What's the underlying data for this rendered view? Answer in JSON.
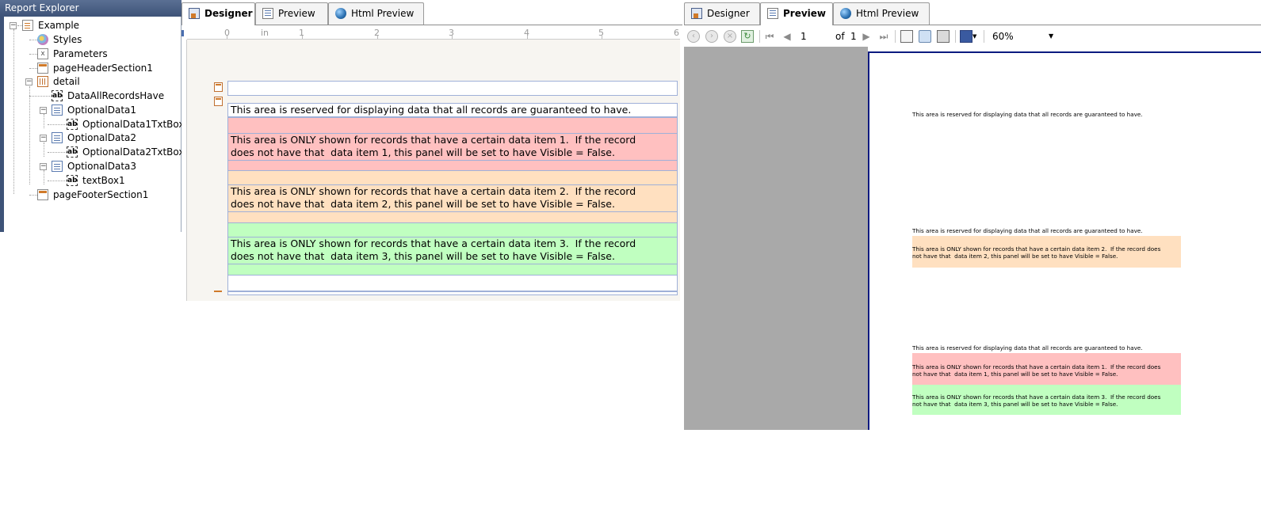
{
  "explorer": {
    "title": "Report Explorer",
    "items": [
      {
        "label": "Example"
      },
      {
        "label": "Styles"
      },
      {
        "label": "Parameters"
      },
      {
        "label": "pageHeaderSection1"
      },
      {
        "label": "detail"
      },
      {
        "label": "DataAllRecordsHave"
      },
      {
        "label": "OptionalData1"
      },
      {
        "label": "OptionalData1TxtBox"
      },
      {
        "label": "OptionalData2"
      },
      {
        "label": "OptionalData2TxtBox"
      },
      {
        "label": "OptionalData3"
      },
      {
        "label": "textBox1"
      },
      {
        "label": "pageFooterSection1"
      }
    ],
    "textbox_glyph": "ab",
    "params_glyph": "x",
    "expander_minus": "−"
  },
  "left_tabs": {
    "designer": "Designer",
    "preview": "Preview",
    "html_preview": "Html Preview",
    "active": "Designer"
  },
  "right_tabs": {
    "designer": "Designer",
    "preview": "Preview",
    "html_preview": "Html Preview",
    "active": "Preview"
  },
  "ruler": {
    "unit": "in",
    "numbers": [
      "0",
      "1",
      "2",
      "3",
      "4",
      "5",
      "6"
    ]
  },
  "designer": {
    "all_records_text": "This area is reserved for displaying data that all records are guaranteed to have.",
    "optional1_text": "This area is ONLY shown for records that have a certain data item 1.  If the record does not have that  data item 1, this panel will be set to have Visible = False.",
    "optional2_text": "This area is ONLY shown for records that have a certain data item 2.  If the record does not have that  data item 2, this panel will be set to have Visible = False.",
    "optional3_text": "This area is ONLY shown for records that have a certain data item 3.  If the record does not have that  data item 3, this panel will be set to have Visible = False."
  },
  "preview_toolbar": {
    "page_value": "1",
    "of_label": "of",
    "total_pages": "1",
    "zoom": "60%"
  },
  "preview_page": {
    "record1_all": "This area is reserved for displaying data that all records are guaranteed to have.",
    "record2_all": "This area is reserved for displaying data that all records are guaranteed to have.",
    "record2_opt2": "This area is ONLY shown for records that have a certain data item 2.  If the record does not have that  data item 2, this panel will be set to have Visible = False.",
    "record3_all": "This area is reserved for displaying data that all records are guaranteed to have.",
    "record3_opt1": "This area is ONLY shown for records that have a certain data item 1.  If the record does not have that  data item 1, this panel will be set to have Visible = False.",
    "record3_opt3": "This area is ONLY shown for records that have a certain data item 3.  If the record does not have that  data item 3, this panel will be set to have Visible = False."
  },
  "colors": {
    "optional1_bg": "#ffc0c0",
    "optional2_bg": "#ffe0c0",
    "optional3_bg": "#c0ffc0",
    "preview_grey": "#a9a9a9",
    "page_border": "#0a1a80"
  },
  "icons": {
    "back": "back-icon",
    "forward": "forward-icon",
    "stop": "stop-icon",
    "refresh": "refresh-icon",
    "first_page": "first-page-icon",
    "prev_page": "prev-page-icon",
    "next_page": "next-page-icon",
    "last_page": "last-page-icon",
    "book": "book-icon",
    "zoom_glass": "zoom-icon",
    "print": "print-icon",
    "save": "save-icon"
  }
}
